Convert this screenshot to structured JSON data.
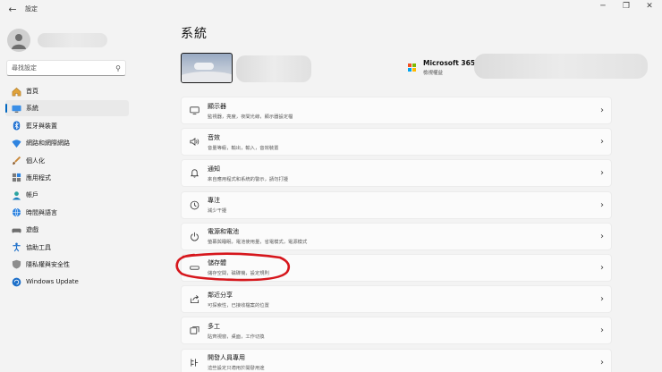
{
  "window": {
    "title": "設定",
    "back_icon": "back-arrow-icon",
    "controls": [
      "minimize",
      "maximize",
      "close"
    ]
  },
  "sidebar": {
    "search_placeholder": "尋找設定",
    "items": [
      {
        "label": "首頁",
        "icon": "home-icon"
      },
      {
        "label": "系統",
        "icon": "system-icon",
        "active": true
      },
      {
        "label": "藍牙與裝置",
        "icon": "bluetooth-icon"
      },
      {
        "label": "網路和網際網路",
        "icon": "network-icon"
      },
      {
        "label": "個人化",
        "icon": "brush-icon"
      },
      {
        "label": "應用程式",
        "icon": "apps-icon"
      },
      {
        "label": "帳戶",
        "icon": "account-icon"
      },
      {
        "label": "時間與語言",
        "icon": "globe-icon"
      },
      {
        "label": "遊戲",
        "icon": "game-icon"
      },
      {
        "label": "協助工具",
        "icon": "accessibility-icon"
      },
      {
        "label": "隱私權與安全性",
        "icon": "shield-icon"
      },
      {
        "label": "Windows Update",
        "icon": "update-icon"
      }
    ]
  },
  "main": {
    "page_title": "系統",
    "ms365": {
      "name": "Microsoft 365",
      "subtitle": "檢視權益"
    },
    "cards": [
      {
        "title": "顯示器",
        "subtitle": "監視器，亮度，夜間光線，顯示器設定檔",
        "icon": "monitor-icon"
      },
      {
        "title": "音效",
        "subtitle": "音量等級，輸出，輸入，音效裝置",
        "icon": "speaker-icon"
      },
      {
        "title": "通知",
        "subtitle": "來自應用程式和系統的警示，請勿打擾",
        "icon": "bell-icon"
      },
      {
        "title": "專注",
        "subtitle": "減少干擾",
        "icon": "focus-icon"
      },
      {
        "title": "電源和電池",
        "subtitle": "螢幕與睡眠，電池使用量，省電模式，電源模式",
        "icon": "power-icon"
      },
      {
        "title": "儲存體",
        "subtitle": "儲存空間，磁碟機，設定規則",
        "icon": "storage-icon"
      },
      {
        "title": "鄰近分享",
        "subtitle": "可探索性，已接收檔案的位置",
        "icon": "share-icon"
      },
      {
        "title": "多工",
        "subtitle": "貼齊視窗，桌面，工作切換",
        "icon": "multitask-icon"
      },
      {
        "title": "開發人員專用",
        "subtitle": "這些設定只適用於開發用途",
        "icon": "developer-icon"
      }
    ]
  },
  "colors": {
    "accent": "#0067c0",
    "annotation": "#d6161c"
  }
}
